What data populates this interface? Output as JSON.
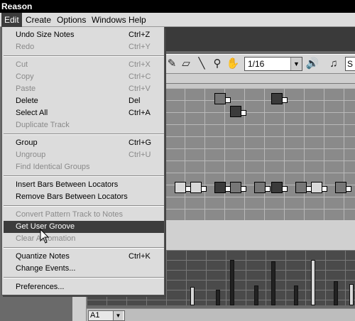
{
  "app": {
    "title": "Reason"
  },
  "menubar": {
    "items": [
      "Edit",
      "Create",
      "Options",
      "Windows",
      "Help"
    ]
  },
  "edit_menu": {
    "items": [
      {
        "label": "Undo Size Notes",
        "shortcut": "Ctrl+Z",
        "enabled": true
      },
      {
        "label": "Redo",
        "shortcut": "Ctrl+Y",
        "enabled": false
      },
      {
        "label": "Cut",
        "shortcut": "Ctrl+X",
        "enabled": false
      },
      {
        "label": "Copy",
        "shortcut": "Ctrl+C",
        "enabled": false
      },
      {
        "label": "Paste",
        "shortcut": "Ctrl+V",
        "enabled": false
      },
      {
        "label": "Delete",
        "shortcut": "Del",
        "enabled": true
      },
      {
        "label": "Select All",
        "shortcut": "Ctrl+A",
        "enabled": true
      },
      {
        "label": "Duplicate Track",
        "shortcut": "",
        "enabled": false
      },
      {
        "label": "Group",
        "shortcut": "Ctrl+G",
        "enabled": true
      },
      {
        "label": "Ungroup",
        "shortcut": "Ctrl+U",
        "enabled": false
      },
      {
        "label": "Find Identical Groups",
        "shortcut": "",
        "enabled": false
      },
      {
        "label": "Insert Bars Between Locators",
        "shortcut": "",
        "enabled": true
      },
      {
        "label": "Remove Bars Between Locators",
        "shortcut": "",
        "enabled": true
      },
      {
        "label": "Convert Pattern Track to Notes",
        "shortcut": "",
        "enabled": false
      },
      {
        "label": "Get User Groove",
        "shortcut": "",
        "enabled": true,
        "highlighted": true
      },
      {
        "label": "Clear Automation",
        "shortcut": "",
        "enabled": false
      },
      {
        "label": "Quantize Notes",
        "shortcut": "Ctrl+K",
        "enabled": true
      },
      {
        "label": "Change Events...",
        "shortcut": "",
        "enabled": true
      },
      {
        "label": "Preferences...",
        "shortcut": "",
        "enabled": true
      }
    ]
  },
  "toolbar": {
    "quantize_value": "1/16",
    "snap_label": "S",
    "icons": [
      "pencil-icon",
      "eraser-icon",
      "line-icon",
      "magnify-icon",
      "hand-icon",
      "speaker-icon",
      "note-icon"
    ]
  },
  "lane_selector": {
    "value": "A1"
  },
  "colors": {
    "menu_bg": "#dcdcdc",
    "highlight": "#3c3c3c",
    "titlebar": "#000000"
  }
}
